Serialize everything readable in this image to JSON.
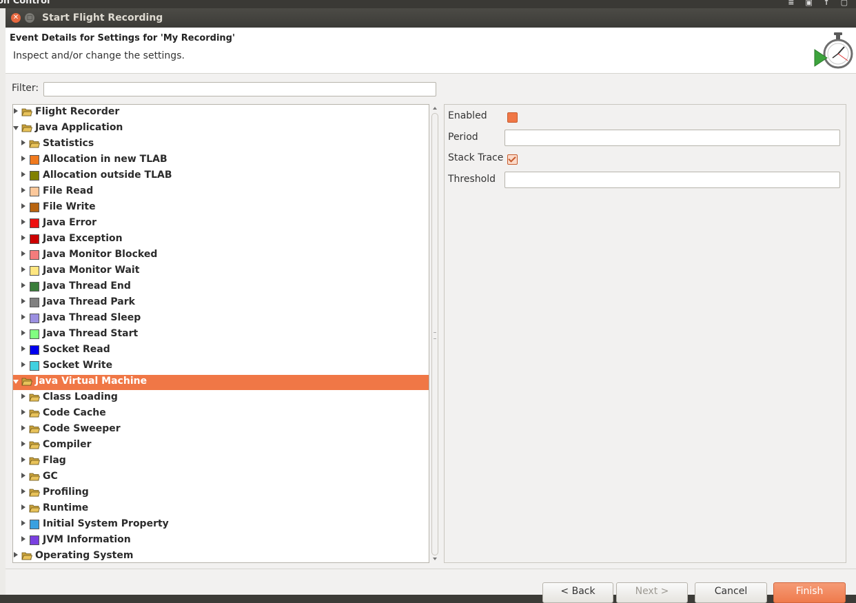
{
  "window": {
    "title": "Start Flight Recording",
    "background_app_title": "on Control"
  },
  "header": {
    "title": "Event Details for Settings for 'My Recording'",
    "subtitle": "Inspect and/or change the settings."
  },
  "filter": {
    "label": "Filter:",
    "value": ""
  },
  "tree": [
    {
      "label": "Flight Recorder",
      "level": 0,
      "kind": "folder",
      "expanded": false
    },
    {
      "label": "Java Application",
      "level": 0,
      "kind": "folder",
      "expanded": true
    },
    {
      "label": "Statistics",
      "level": 1,
      "kind": "folder",
      "expanded": false
    },
    {
      "label": "Allocation in new TLAB",
      "level": 1,
      "kind": "event",
      "color": "#f07a1e"
    },
    {
      "label": "Allocation outside TLAB",
      "level": 1,
      "kind": "event",
      "color": "#808000"
    },
    {
      "label": "File Read",
      "level": 1,
      "kind": "event",
      "color": "#fcc89b"
    },
    {
      "label": "File Write",
      "level": 1,
      "kind": "event",
      "color": "#b86410"
    },
    {
      "label": "Java Error",
      "level": 1,
      "kind": "event",
      "color": "#ee1111"
    },
    {
      "label": "Java Exception",
      "level": 1,
      "kind": "event",
      "color": "#cc0000"
    },
    {
      "label": "Java Monitor Blocked",
      "level": 1,
      "kind": "event",
      "color": "#f47c7c"
    },
    {
      "label": "Java Monitor Wait",
      "level": 1,
      "kind": "event",
      "color": "#ffe680"
    },
    {
      "label": "Java Thread End",
      "level": 1,
      "kind": "event",
      "color": "#3a7d3a"
    },
    {
      "label": "Java Thread Park",
      "level": 1,
      "kind": "event",
      "color": "#808080"
    },
    {
      "label": "Java Thread Sleep",
      "level": 1,
      "kind": "event",
      "color": "#9b8fe0"
    },
    {
      "label": "Java Thread Start",
      "level": 1,
      "kind": "event",
      "color": "#80ff80"
    },
    {
      "label": "Socket Read",
      "level": 1,
      "kind": "event",
      "color": "#0000ee"
    },
    {
      "label": "Socket Write",
      "level": 1,
      "kind": "event",
      "color": "#40d0e0"
    },
    {
      "label": "Java Virtual Machine",
      "level": 0,
      "kind": "folder",
      "expanded": true,
      "selected": true
    },
    {
      "label": "Class Loading",
      "level": 1,
      "kind": "folder",
      "expanded": false
    },
    {
      "label": "Code Cache",
      "level": 1,
      "kind": "folder",
      "expanded": false
    },
    {
      "label": "Code Sweeper",
      "level": 1,
      "kind": "folder",
      "expanded": false
    },
    {
      "label": "Compiler",
      "level": 1,
      "kind": "folder",
      "expanded": false
    },
    {
      "label": "Flag",
      "level": 1,
      "kind": "folder",
      "expanded": false
    },
    {
      "label": "GC",
      "level": 1,
      "kind": "folder",
      "expanded": false
    },
    {
      "label": "Profiling",
      "level": 1,
      "kind": "folder",
      "expanded": false
    },
    {
      "label": "Runtime",
      "level": 1,
      "kind": "folder",
      "expanded": false
    },
    {
      "label": "Initial System Property",
      "level": 1,
      "kind": "event",
      "color": "#3aa0e0"
    },
    {
      "label": "JVM Information",
      "level": 1,
      "kind": "event",
      "color": "#7a40e0"
    },
    {
      "label": "Operating System",
      "level": 0,
      "kind": "folder",
      "expanded": false
    }
  ],
  "properties": {
    "enabled": {
      "label": "Enabled",
      "checked": false
    },
    "period": {
      "label": "Period",
      "value": ""
    },
    "stack_trace": {
      "label": "Stack Trace",
      "checked": true
    },
    "threshold": {
      "label": "Threshold",
      "value": ""
    }
  },
  "buttons": {
    "back": "< Back",
    "next": "Next >",
    "cancel": "Cancel",
    "finish": "Finish"
  },
  "colors": {
    "accent": "#f07746",
    "title_bar": "#3c3b37",
    "folder": "#e8c25a"
  }
}
